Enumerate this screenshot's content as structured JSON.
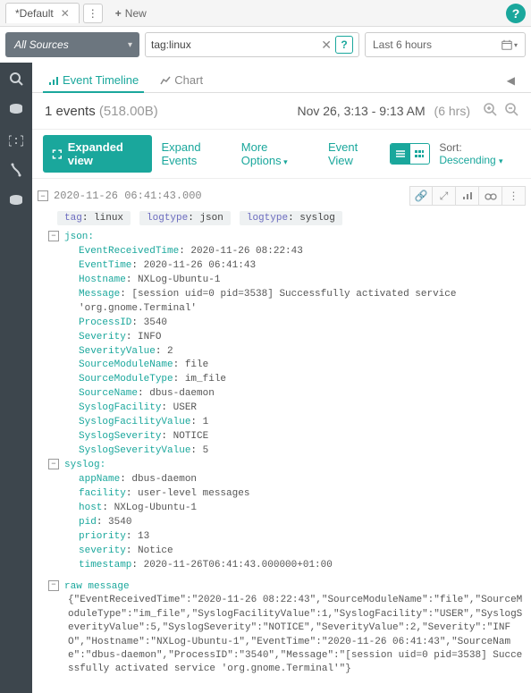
{
  "tabs": {
    "default_label": "*Default",
    "new_label": "New"
  },
  "filter": {
    "sources_label": "All Sources",
    "search_value": "tag:linux",
    "time_label": "Last 6 hours"
  },
  "view_tabs": {
    "timeline": "Event Timeline",
    "chart": "Chart"
  },
  "summary": {
    "events": "1 events",
    "bytes": "(518.00B)",
    "range": "Nov 26, 3:13 - 9:13 AM",
    "duration": "(6 hrs)"
  },
  "toolbar": {
    "expanded_view": "Expanded view",
    "expand_events": "Expand Events",
    "more_options": "More Options",
    "event_view": "Event View",
    "sort_label": "Sort:",
    "sort_value": "Descending"
  },
  "event": {
    "timestamp": "2020-11-26 06:41:43.000",
    "tags": [
      {
        "k": "tag",
        "v": "linux"
      },
      {
        "k": "logtype",
        "v": "json"
      },
      {
        "k": "logtype",
        "v": "syslog"
      }
    ],
    "json_label": "json:",
    "json": [
      {
        "k": "EventReceivedTime",
        "v": "2020-11-26 08:22:43"
      },
      {
        "k": "EventTime",
        "v": "2020-11-26 06:41:43"
      },
      {
        "k": "Hostname",
        "v": "NXLog-Ubuntu-1"
      },
      {
        "k": "Message",
        "v": "[session uid=0 pid=3538] Successfully activated service 'org.gnome.Terminal'"
      },
      {
        "k": "ProcessID",
        "v": "3540"
      },
      {
        "k": "Severity",
        "v": "INFO"
      },
      {
        "k": "SeverityValue",
        "v": "2"
      },
      {
        "k": "SourceModuleName",
        "v": "file"
      },
      {
        "k": "SourceModuleType",
        "v": "im_file"
      },
      {
        "k": "SourceName",
        "v": "dbus-daemon"
      },
      {
        "k": "SyslogFacility",
        "v": "USER"
      },
      {
        "k": "SyslogFacilityValue",
        "v": "1"
      },
      {
        "k": "SyslogSeverity",
        "v": "NOTICE"
      },
      {
        "k": "SyslogSeverityValue",
        "v": "5"
      }
    ],
    "syslog_label": "syslog:",
    "syslog": [
      {
        "k": "appName",
        "v": "dbus-daemon"
      },
      {
        "k": "facility",
        "v": "user-level messages"
      },
      {
        "k": "host",
        "v": "NXLog-Ubuntu-1"
      },
      {
        "k": "pid",
        "v": "3540"
      },
      {
        "k": "priority",
        "v": "13"
      },
      {
        "k": "severity",
        "v": "Notice"
      },
      {
        "k": "timestamp",
        "v": "2020-11-26T06:41:43.000000+01:00"
      }
    ],
    "raw_label": "raw message",
    "raw_body": "{\"EventReceivedTime\":\"2020-11-26 08:22:43\",\"SourceModuleName\":\"file\",\"SourceModuleType\":\"im_file\",\"SyslogFacilityValue\":1,\"SyslogFacility\":\"USER\",\"SyslogSeverityValue\":5,\"SyslogSeverity\":\"NOTICE\",\"SeverityValue\":2,\"Severity\":\"INFO\",\"Hostname\":\"NXLog-Ubuntu-1\",\"EventTime\":\"2020-11-26 06:41:43\",\"SourceName\":\"dbus-daemon\",\"ProcessID\":\"3540\",\"Message\":\"[session uid=0 pid=3538] Successfully activated service 'org.gnome.Terminal'\"}"
  }
}
